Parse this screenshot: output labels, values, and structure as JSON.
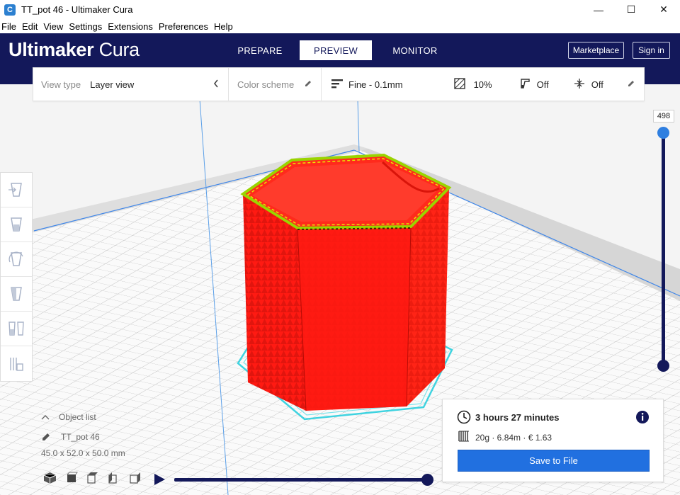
{
  "window": {
    "title": "TT_pot 46 - Ultimaker Cura",
    "app_icon": "C",
    "minimize": "—",
    "maximize": "☐",
    "close": "✕"
  },
  "menu": [
    "File",
    "Edit",
    "View",
    "Settings",
    "Extensions",
    "Preferences",
    "Help"
  ],
  "header": {
    "brand_bold": "Ultimaker",
    "brand_light": "Cura",
    "tabs": [
      "PREPARE",
      "PREVIEW",
      "MONITOR"
    ],
    "active_tab": "PREVIEW",
    "marketplace": "Marketplace",
    "sign_in": "Sign in"
  },
  "toolbar": {
    "view_type_label": "View type",
    "view_type_value": "Layer view",
    "color_scheme_label": "Color scheme",
    "profile": "Fine - 0.1mm",
    "infill": "10%",
    "support": "Off",
    "adhesion": "Off"
  },
  "layer_slider": {
    "current_layer": "498",
    "level": 1.0
  },
  "object_list": {
    "title": "Object list",
    "object_name": "TT_pot 46",
    "dimensions": "45.0 x 52.0 x 50.0 mm"
  },
  "simulation": {
    "progress": 1.0
  },
  "print_info": {
    "time": "3 hours 27 minutes",
    "material": "20g · 6.84m · € 1.63",
    "save_button": "Save to File"
  },
  "colors": {
    "header_bg": "#13185a",
    "accent": "#2170e0",
    "model": "#ff1a12",
    "build_outline": "#3fd3e0"
  }
}
